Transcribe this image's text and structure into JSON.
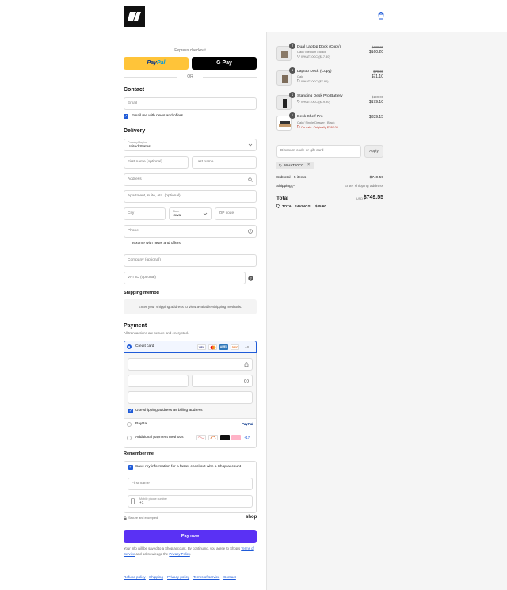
{
  "header": {
    "brand_icon": "store-logo",
    "cart_icon": "shopping-bag-icon"
  },
  "express": {
    "title": "Express checkout",
    "paypal_a": "Pay",
    "paypal_b": "Pal",
    "gpay": "G Pay",
    "or": "OR"
  },
  "contact": {
    "heading": "Contact",
    "email_placeholder": "Email",
    "news_label": "Email me with news and offers"
  },
  "delivery": {
    "heading": "Delivery",
    "country_label": "Country/Region",
    "country_value": "United States",
    "first_name": "First name (optional)",
    "last_name": "Last name",
    "address": "Address",
    "apartment": "Apartment, suite, etc. (optional)",
    "city": "City",
    "state_label": "State",
    "state_value": "Iowa",
    "zip": "ZIP code",
    "phone": "Phone",
    "text_label": "Text me with news and offers",
    "company": "Company (optional)",
    "vat": "VAT ID (optional)"
  },
  "shipping": {
    "heading": "Shipping method",
    "message": "Enter your shipping address to view available shipping methods."
  },
  "payment": {
    "heading": "Payment",
    "subtitle": "All transactions are secure and encrypted.",
    "credit_card": "Credit card",
    "cards": [
      "VISA",
      "MC",
      "AMEX",
      "DISC"
    ],
    "more_cards": "+4",
    "billing_label": "Use shipping address as billing address",
    "paypal": "PayPal",
    "paypal_logo": "PayPal",
    "additional": "Additional payment methods",
    "additional_more": "+17",
    "colors": {
      "accent": "#1f5bd8",
      "paynow": "#5a31f4"
    }
  },
  "remember": {
    "heading": "Remember me",
    "save_label": "Save my information for a faster checkout with a Shop account",
    "first_name": "First name",
    "mobile_label": "Mobile phone number",
    "mobile_prefix": "+1",
    "secure": "Secure and encrypted",
    "shop_logo": "shop"
  },
  "paynow": {
    "label": "Pay now",
    "legal_1": "Your info will be saved to a Shop account. By continuing, you agree to Shop's",
    "terms": "Terms of Service",
    "legal_2": "and acknowledge the",
    "privacy": "Privacy Policy",
    "legal_end": "."
  },
  "footer": {
    "links": [
      "Refund policy",
      "Shipping",
      "Privacy policy",
      "Terms of service",
      "Contact"
    ]
  },
  "summary": {
    "items": [
      {
        "qty": "2",
        "name": "Dual Laptop Dock (Copy)",
        "variant": "Oak / Medium / Black",
        "discount": "WHAT10CC ($17.80)",
        "original": "$178.00",
        "price": "$160.20"
      },
      {
        "qty": "1",
        "name": "Laptop Dock (Copy)",
        "variant": "Oak",
        "discount": "WHAT10CC ($7.90)",
        "original": "$79.00",
        "price": "$71.10"
      },
      {
        "qty": "1",
        "name": "Standing Desk Pro Battery",
        "variant": "",
        "discount": "WHAT10CC ($19.90)",
        "original": "$199.00",
        "price": "$179.10"
      },
      {
        "qty": "1",
        "name": "Desk Shelf Pro",
        "variant": "Oak / Single Drawer / Black",
        "discount": "On sale. Originally $389.00",
        "original": "",
        "price": "$339.15"
      }
    ],
    "discount_placeholder": "Discount code or gift card",
    "apply": "Apply",
    "code": "WHAT10CC",
    "subtotal_label": "Subtotal · 5 items",
    "subtotal_value": "$749.55",
    "shipping_label": "Shipping",
    "shipping_value": "Enter shipping address",
    "total_label": "Total",
    "currency": "USD",
    "total_value": "$749.55",
    "savings_label": "TOTAL SAVINGS",
    "savings_value": "$45.60"
  }
}
